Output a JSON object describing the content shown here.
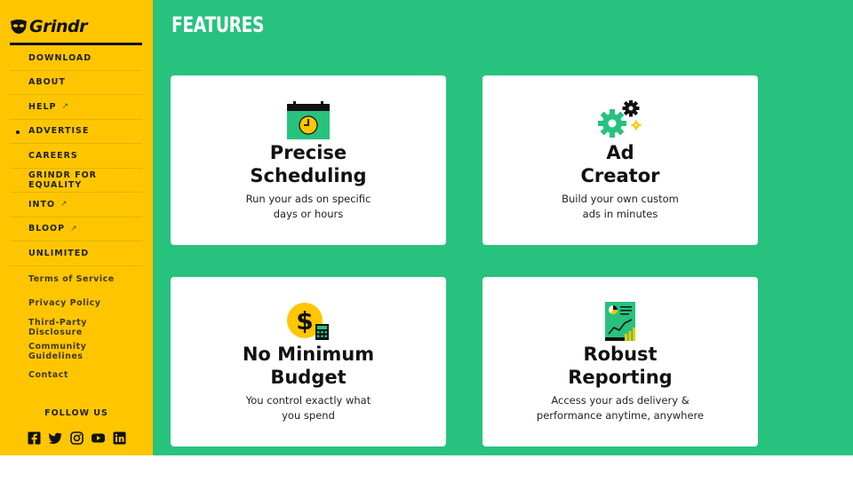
{
  "brand": {
    "name": "Grindr"
  },
  "sidebar": {
    "nav": [
      {
        "label": "DOWNLOAD",
        "external": false,
        "active": false
      },
      {
        "label": "ABOUT",
        "external": false,
        "active": false
      },
      {
        "label": "HELP",
        "external": true,
        "active": false
      },
      {
        "label": "ADVERTISE",
        "external": false,
        "active": true
      },
      {
        "label": "CAREERS",
        "external": false,
        "active": false
      },
      {
        "label": "GRINDR FOR EQUALITY",
        "external": false,
        "active": false
      },
      {
        "label": "INTO",
        "external": true,
        "active": false
      },
      {
        "label": "BLOOP",
        "external": true,
        "active": false
      },
      {
        "label": "UNLIMITED",
        "external": false,
        "active": false
      }
    ],
    "external_glyph": "↗",
    "links": [
      {
        "label": "Terms of Service"
      },
      {
        "label": "Privacy Policy"
      },
      {
        "label": "Third-Party Disclosure"
      },
      {
        "label": "Community Guidelines"
      },
      {
        "label": "Contact"
      }
    ],
    "follow_label": "FOLLOW US",
    "social": [
      "facebook-icon",
      "twitter-icon",
      "instagram-icon",
      "youtube-icon",
      "linkedin-icon"
    ]
  },
  "main": {
    "title": "FEATURES",
    "cards": [
      {
        "icon": "calendar-clock-icon",
        "title_line1": "Precise",
        "title_line2": "Scheduling",
        "desc_line1": "Run your ads on specific",
        "desc_line2": "days or hours"
      },
      {
        "icon": "gears-icon",
        "title_line1": "Ad",
        "title_line2": "Creator",
        "desc_line1": "Build your own custom",
        "desc_line2": "ads in minutes"
      },
      {
        "icon": "dollar-calculator-icon",
        "title_line1": "No Minimum",
        "title_line2": "Budget",
        "desc_line1": "You control exactly what",
        "desc_line2": "you spend"
      },
      {
        "icon": "report-chart-icon",
        "title_line1": "Robust",
        "title_line2": "Reporting",
        "desc_line1": "Access your ads delivery &",
        "desc_line2": "performance anytime, anywhere"
      }
    ]
  },
  "colors": {
    "sidebar": "#ffc600",
    "main": "#27c27e",
    "card": "#ffffff",
    "text": "#111111"
  }
}
